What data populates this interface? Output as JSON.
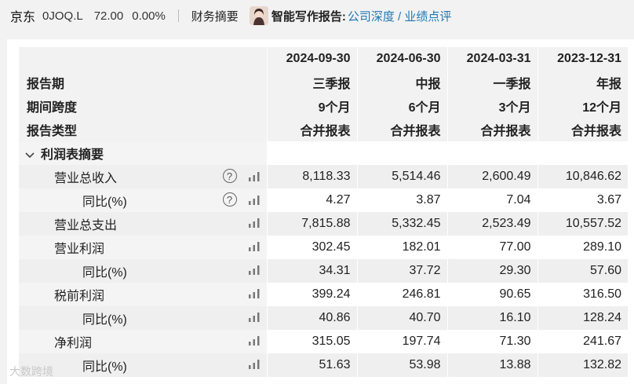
{
  "topbar": {
    "stock_name": "京东",
    "stock_code": "0JOQ.L",
    "price": "72.00",
    "change": "0.00%",
    "nav_summary": "财务摘要",
    "ai_label": "智能写作报告:",
    "ai_links": "公司深度 / 业绩点评"
  },
  "header": {
    "row0_label": "",
    "row1_label": "报告期",
    "row2_label": "期间跨度",
    "row3_label": "报告类型",
    "columns": [
      {
        "date": "2024-09-30",
        "period": "三季报",
        "span": "9个月",
        "type": "合并报表"
      },
      {
        "date": "2024-06-30",
        "period": "中报",
        "span": "6个月",
        "type": "合并报表"
      },
      {
        "date": "2024-03-31",
        "period": "一季报",
        "span": "3个月",
        "type": "合并报表"
      },
      {
        "date": "2023-12-31",
        "period": "年报",
        "span": "12个月",
        "type": "合并报表"
      }
    ]
  },
  "section": {
    "title": "利润表摘要"
  },
  "rows": [
    {
      "label": "营业总收入",
      "values": [
        "8,118.33",
        "5,514.46",
        "2,600.49",
        "10,846.62"
      ]
    },
    {
      "label": "同比(%)",
      "values": [
        "4.27",
        "3.87",
        "7.04",
        "3.67"
      ]
    },
    {
      "label": "营业总支出",
      "values": [
        "7,815.88",
        "5,332.45",
        "2,523.49",
        "10,557.52"
      ]
    },
    {
      "label": "营业利润",
      "values": [
        "302.45",
        "182.01",
        "77.00",
        "289.10"
      ]
    },
    {
      "label": "同比(%)",
      "values": [
        "34.31",
        "37.72",
        "29.30",
        "57.60"
      ]
    },
    {
      "label": "税前利润",
      "values": [
        "399.24",
        "246.81",
        "90.65",
        "316.50"
      ]
    },
    {
      "label": "同比(%)",
      "values": [
        "40.86",
        "40.70",
        "16.10",
        "128.24"
      ]
    },
    {
      "label": "净利润",
      "values": [
        "315.05",
        "197.74",
        "71.30",
        "241.67"
      ]
    },
    {
      "label": "同比(%)",
      "values": [
        "51.63",
        "53.98",
        "13.88",
        "132.82"
      ]
    }
  ],
  "watermark": "大数跨境",
  "icons": {
    "help": "question-circle-icon",
    "chart": "bar-chart-icon",
    "toggle": "chevron-down-icon"
  }
}
